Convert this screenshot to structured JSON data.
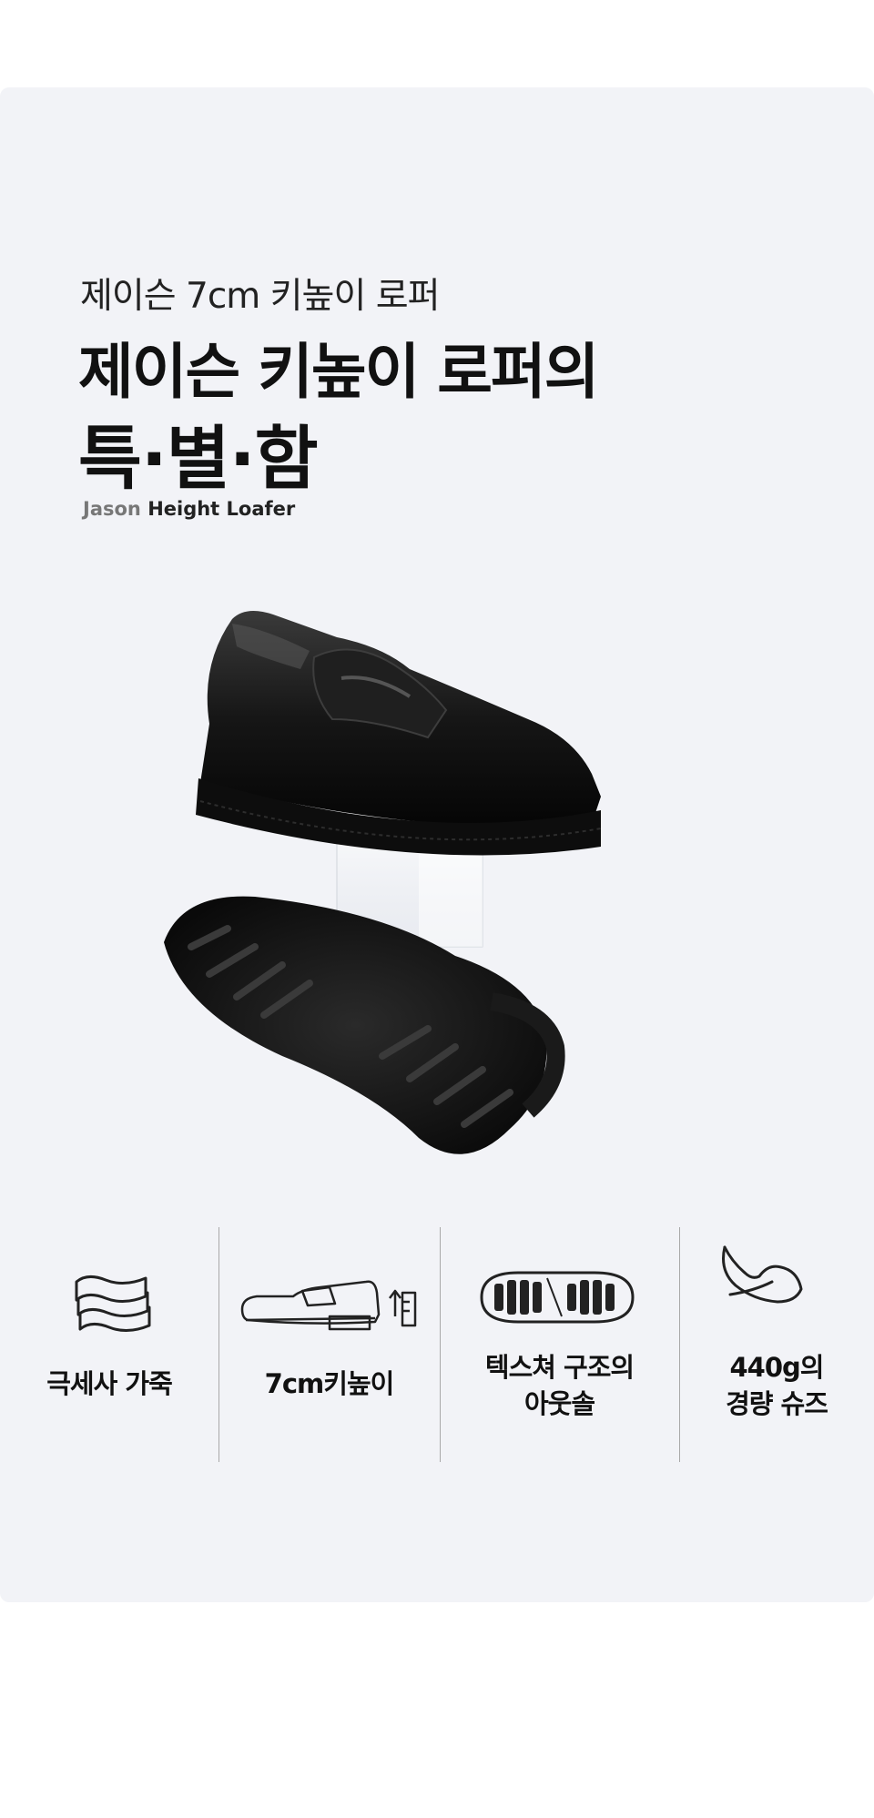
{
  "header": {
    "subtitle": "제이슨 7cm 키높이 로퍼",
    "title_line1": "제이슨 키높이 로퍼의",
    "title_line2": "특·별·함",
    "tag_primary": "Jason",
    "tag_secondary": "Height Loafer"
  },
  "product_image": {
    "icon": "loafer-photo"
  },
  "features": [
    {
      "icon": "layered-leather-icon",
      "lines": [
        "극세사 가죽"
      ]
    },
    {
      "icon": "shoe-height-icon",
      "lines": [
        "7cm키높이"
      ]
    },
    {
      "icon": "outsole-icon",
      "lines": [
        "텍스쳐 구조의",
        "아웃솔"
      ]
    },
    {
      "icon": "feather-icon",
      "lines": [
        "440g의",
        "경량 슈즈"
      ]
    }
  ],
  "colors": {
    "panel": "#f2f3f7",
    "text": "#111111",
    "accent_gray": "#777777"
  }
}
